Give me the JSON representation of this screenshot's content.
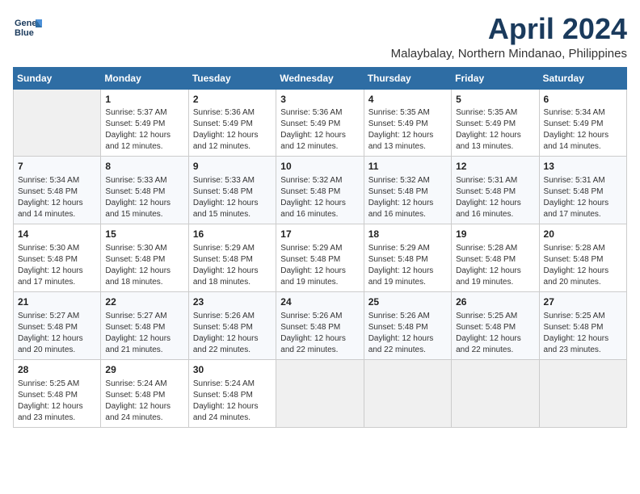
{
  "logo": {
    "line1": "General",
    "line2": "Blue"
  },
  "title": "April 2024",
  "location": "Malaybalay, Northern Mindanao, Philippines",
  "weekdays": [
    "Sunday",
    "Monday",
    "Tuesday",
    "Wednesday",
    "Thursday",
    "Friday",
    "Saturday"
  ],
  "weeks": [
    [
      {
        "day": "",
        "empty": true
      },
      {
        "day": "1",
        "sunrise": "Sunrise: 5:37 AM",
        "sunset": "Sunset: 5:49 PM",
        "daylight": "Daylight: 12 hours and 12 minutes."
      },
      {
        "day": "2",
        "sunrise": "Sunrise: 5:36 AM",
        "sunset": "Sunset: 5:49 PM",
        "daylight": "Daylight: 12 hours and 12 minutes."
      },
      {
        "day": "3",
        "sunrise": "Sunrise: 5:36 AM",
        "sunset": "Sunset: 5:49 PM",
        "daylight": "Daylight: 12 hours and 12 minutes."
      },
      {
        "day": "4",
        "sunrise": "Sunrise: 5:35 AM",
        "sunset": "Sunset: 5:49 PM",
        "daylight": "Daylight: 12 hours and 13 minutes."
      },
      {
        "day": "5",
        "sunrise": "Sunrise: 5:35 AM",
        "sunset": "Sunset: 5:49 PM",
        "daylight": "Daylight: 12 hours and 13 minutes."
      },
      {
        "day": "6",
        "sunrise": "Sunrise: 5:34 AM",
        "sunset": "Sunset: 5:49 PM",
        "daylight": "Daylight: 12 hours and 14 minutes."
      }
    ],
    [
      {
        "day": "7",
        "sunrise": "Sunrise: 5:34 AM",
        "sunset": "Sunset: 5:48 PM",
        "daylight": "Daylight: 12 hours and 14 minutes."
      },
      {
        "day": "8",
        "sunrise": "Sunrise: 5:33 AM",
        "sunset": "Sunset: 5:48 PM",
        "daylight": "Daylight: 12 hours and 15 minutes."
      },
      {
        "day": "9",
        "sunrise": "Sunrise: 5:33 AM",
        "sunset": "Sunset: 5:48 PM",
        "daylight": "Daylight: 12 hours and 15 minutes."
      },
      {
        "day": "10",
        "sunrise": "Sunrise: 5:32 AM",
        "sunset": "Sunset: 5:48 PM",
        "daylight": "Daylight: 12 hours and 16 minutes."
      },
      {
        "day": "11",
        "sunrise": "Sunrise: 5:32 AM",
        "sunset": "Sunset: 5:48 PM",
        "daylight": "Daylight: 12 hours and 16 minutes."
      },
      {
        "day": "12",
        "sunrise": "Sunrise: 5:31 AM",
        "sunset": "Sunset: 5:48 PM",
        "daylight": "Daylight: 12 hours and 16 minutes."
      },
      {
        "day": "13",
        "sunrise": "Sunrise: 5:31 AM",
        "sunset": "Sunset: 5:48 PM",
        "daylight": "Daylight: 12 hours and 17 minutes."
      }
    ],
    [
      {
        "day": "14",
        "sunrise": "Sunrise: 5:30 AM",
        "sunset": "Sunset: 5:48 PM",
        "daylight": "Daylight: 12 hours and 17 minutes."
      },
      {
        "day": "15",
        "sunrise": "Sunrise: 5:30 AM",
        "sunset": "Sunset: 5:48 PM",
        "daylight": "Daylight: 12 hours and 18 minutes."
      },
      {
        "day": "16",
        "sunrise": "Sunrise: 5:29 AM",
        "sunset": "Sunset: 5:48 PM",
        "daylight": "Daylight: 12 hours and 18 minutes."
      },
      {
        "day": "17",
        "sunrise": "Sunrise: 5:29 AM",
        "sunset": "Sunset: 5:48 PM",
        "daylight": "Daylight: 12 hours and 19 minutes."
      },
      {
        "day": "18",
        "sunrise": "Sunrise: 5:29 AM",
        "sunset": "Sunset: 5:48 PM",
        "daylight": "Daylight: 12 hours and 19 minutes."
      },
      {
        "day": "19",
        "sunrise": "Sunrise: 5:28 AM",
        "sunset": "Sunset: 5:48 PM",
        "daylight": "Daylight: 12 hours and 19 minutes."
      },
      {
        "day": "20",
        "sunrise": "Sunrise: 5:28 AM",
        "sunset": "Sunset: 5:48 PM",
        "daylight": "Daylight: 12 hours and 20 minutes."
      }
    ],
    [
      {
        "day": "21",
        "sunrise": "Sunrise: 5:27 AM",
        "sunset": "Sunset: 5:48 PM",
        "daylight": "Daylight: 12 hours and 20 minutes."
      },
      {
        "day": "22",
        "sunrise": "Sunrise: 5:27 AM",
        "sunset": "Sunset: 5:48 PM",
        "daylight": "Daylight: 12 hours and 21 minutes."
      },
      {
        "day": "23",
        "sunrise": "Sunrise: 5:26 AM",
        "sunset": "Sunset: 5:48 PM",
        "daylight": "Daylight: 12 hours and 22 minutes."
      },
      {
        "day": "24",
        "sunrise": "Sunrise: 5:26 AM",
        "sunset": "Sunset: 5:48 PM",
        "daylight": "Daylight: 12 hours and 22 minutes."
      },
      {
        "day": "25",
        "sunrise": "Sunrise: 5:26 AM",
        "sunset": "Sunset: 5:48 PM",
        "daylight": "Daylight: 12 hours and 22 minutes."
      },
      {
        "day": "26",
        "sunrise": "Sunrise: 5:25 AM",
        "sunset": "Sunset: 5:48 PM",
        "daylight": "Daylight: 12 hours and 22 minutes."
      },
      {
        "day": "27",
        "sunrise": "Sunrise: 5:25 AM",
        "sunset": "Sunset: 5:48 PM",
        "daylight": "Daylight: 12 hours and 23 minutes."
      }
    ],
    [
      {
        "day": "28",
        "sunrise": "Sunrise: 5:25 AM",
        "sunset": "Sunset: 5:48 PM",
        "daylight": "Daylight: 12 hours and 23 minutes."
      },
      {
        "day": "29",
        "sunrise": "Sunrise: 5:24 AM",
        "sunset": "Sunset: 5:48 PM",
        "daylight": "Daylight: 12 hours and 24 minutes."
      },
      {
        "day": "30",
        "sunrise": "Sunrise: 5:24 AM",
        "sunset": "Sunset: 5:48 PM",
        "daylight": "Daylight: 12 hours and 24 minutes."
      },
      {
        "day": "",
        "empty": true
      },
      {
        "day": "",
        "empty": true
      },
      {
        "day": "",
        "empty": true
      },
      {
        "day": "",
        "empty": true
      }
    ]
  ]
}
